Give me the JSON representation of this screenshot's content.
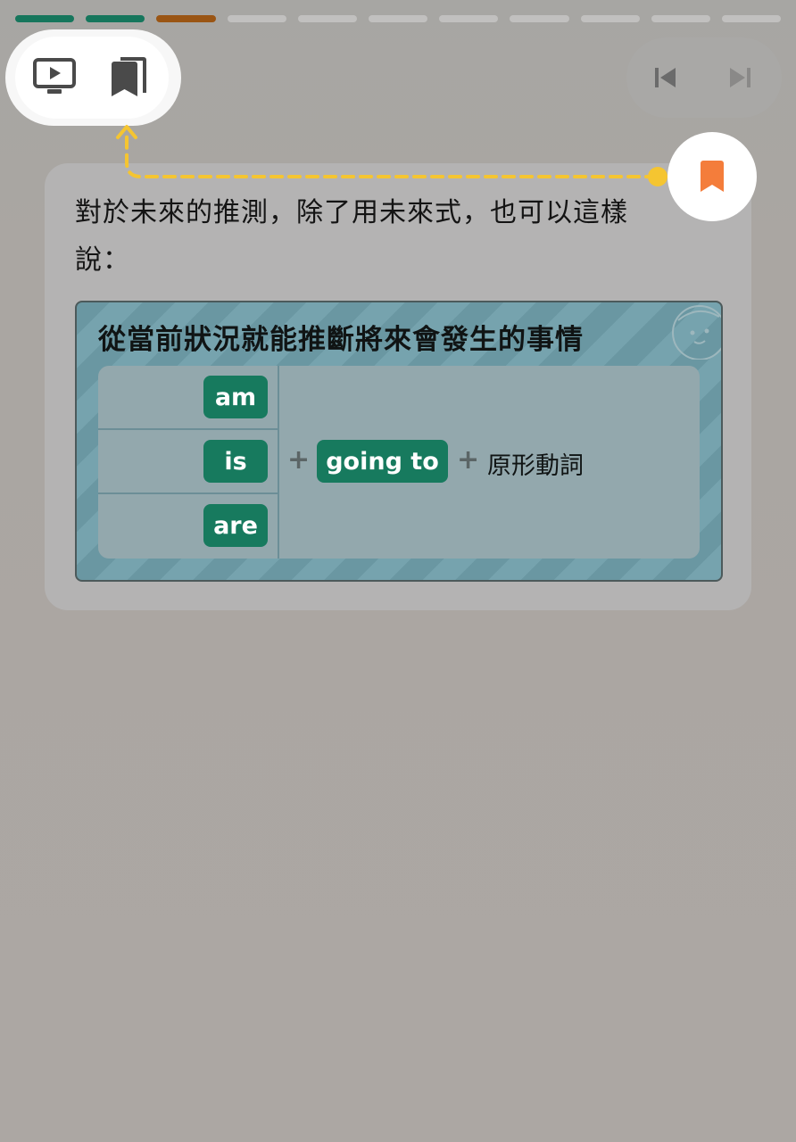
{
  "progress": {
    "segments": [
      "done",
      "done",
      "current",
      "todo",
      "todo",
      "todo",
      "todo",
      "todo",
      "todo",
      "todo",
      "todo"
    ]
  },
  "toolbar": {
    "video_icon": "play-video-icon",
    "bookmarks_icon": "bookmarks-icon"
  },
  "nav": {
    "prev_icon": "skip-previous-icon",
    "next_icon": "skip-next-icon"
  },
  "tutorial": {
    "bookmark_icon": "bookmark-icon",
    "accent_color": "#f5c531",
    "bookmark_color": "#f47d3b"
  },
  "card": {
    "intro_text": "對於未來的推測，除了用未來式，也可以這樣說："
  },
  "grammar": {
    "title": "從當前狀況就能推斷將來會發生的事情",
    "subjects_be": [
      "am",
      "is",
      "are"
    ],
    "plus_1": "+",
    "going_to": "going to",
    "plus_2": "+",
    "verb": "原形動詞"
  },
  "colors": {
    "progress_done": "#16765c",
    "progress_current": "#9a5514",
    "pill_green": "#177a5e"
  }
}
